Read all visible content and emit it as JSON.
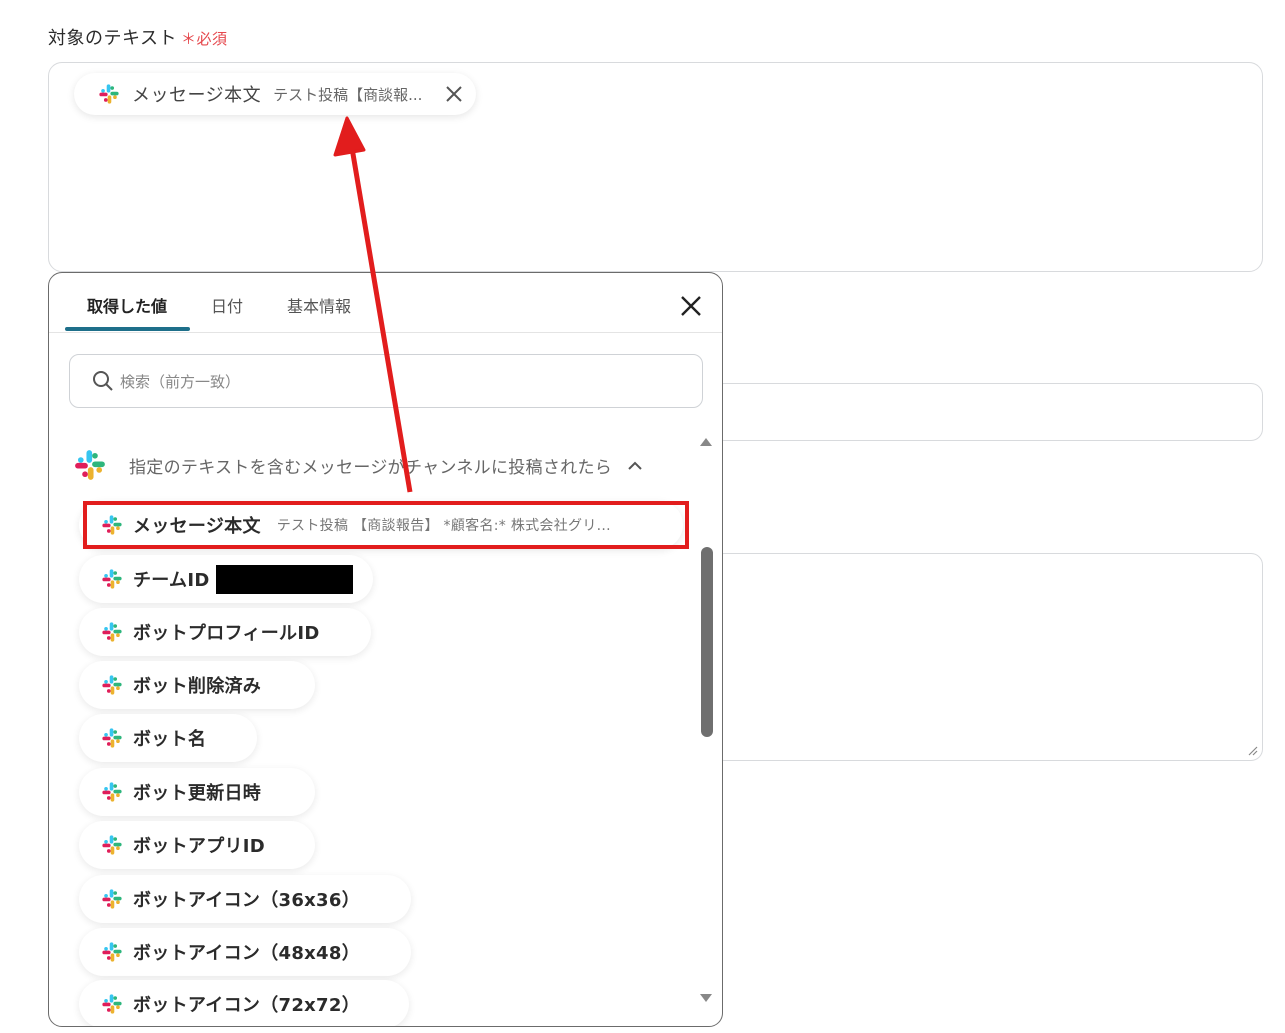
{
  "field": {
    "label": "対象のテキスト",
    "required_mark": "＊必須",
    "chip_name": "メッセージ本文",
    "chip_value": "テスト投稿【商談報..."
  },
  "popup": {
    "tabs": [
      {
        "label": "取得した値"
      },
      {
        "label": "日付"
      },
      {
        "label": "基本情報"
      }
    ],
    "search_placeholder": "検索（前方一致）",
    "group_title": "指定のテキストを含むメッセージがチャンネルに投稿されたら",
    "items": [
      {
        "name": "メッセージ本文",
        "value": "テスト投稿 【商談報告】 *顧客名:* 株式会社グリ..."
      },
      {
        "name": "チームID",
        "value": ""
      },
      {
        "name": "ボットプロフィールID",
        "value": ""
      },
      {
        "name": "ボット削除済み",
        "value": ""
      },
      {
        "name": "ボット名",
        "value": ""
      },
      {
        "name": "ボット更新日時",
        "value": ""
      },
      {
        "name": "ボットアプリID",
        "value": ""
      },
      {
        "name": "ボットアイコン（36x36）",
        "value": ""
      },
      {
        "name": "ボットアイコン（48x48）",
        "value": ""
      },
      {
        "name": "ボットアイコン（72x72）",
        "value": ""
      }
    ]
  },
  "icons": {
    "app_icon": "slack-icon",
    "remove": "close-icon",
    "popup_close": "close-icon",
    "search": "search-icon",
    "collapse": "chevron-up-icon"
  },
  "colors": {
    "required": "#e5484d",
    "active_tab": "#1e6f8a",
    "annotation": "#e21d1d",
    "slack": [
      "#36c5f0",
      "#2eb67d",
      "#ecb22e",
      "#e01e5a"
    ]
  },
  "annotations": {
    "highlight_target": "メッセージ本文"
  }
}
